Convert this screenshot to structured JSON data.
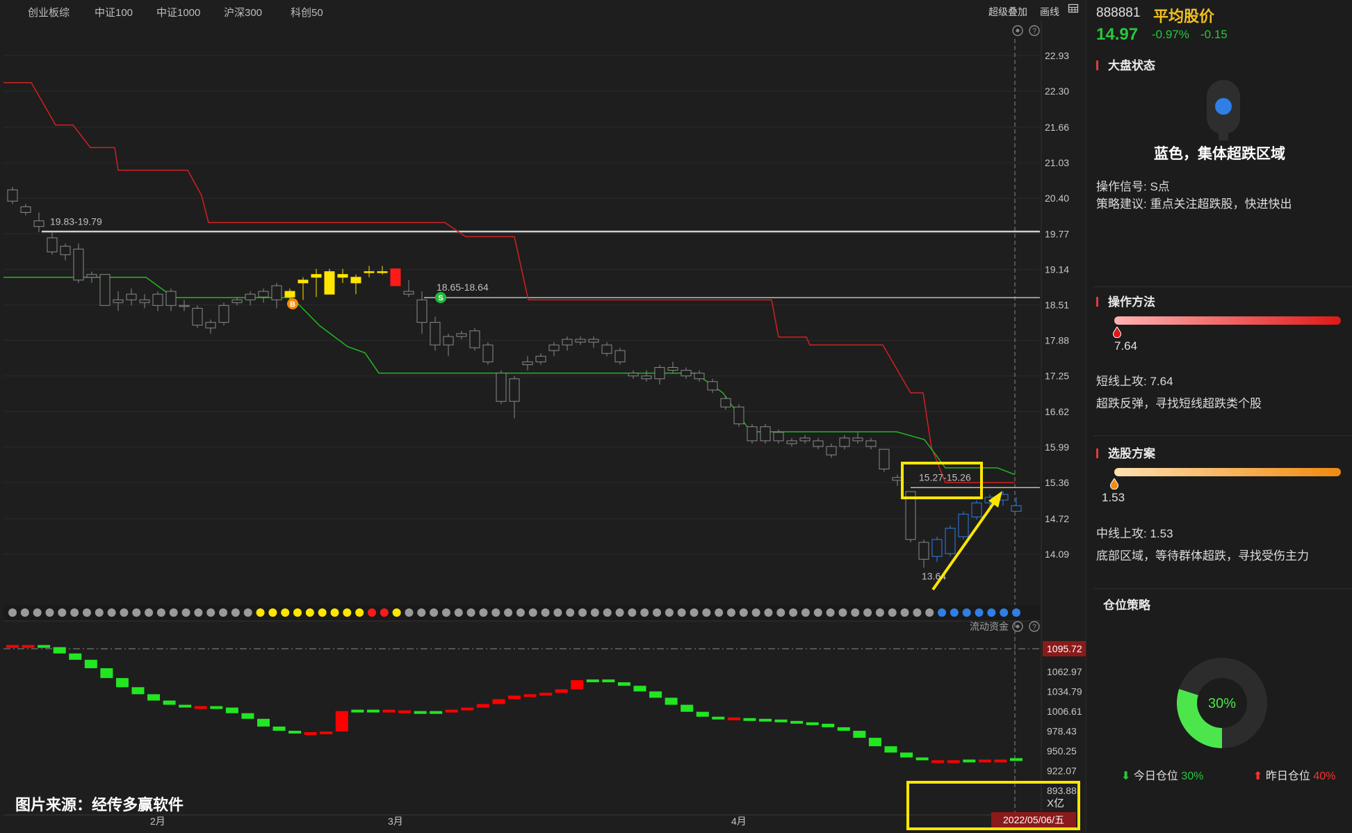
{
  "tabs": [
    "创业板综",
    "中证100",
    "中证1000",
    "沪深300",
    "科创50"
  ],
  "toolbar": {
    "overlay": "超级叠加",
    "draw": "画线",
    "grid_icon": "grid-icon"
  },
  "chart_data": [
    {
      "type": "candlestick",
      "title": "",
      "y_tick_labels": [
        "22.93",
        "22.30",
        "21.66",
        "21.03",
        "20.40",
        "19.77",
        "19.14",
        "18.51",
        "17.88",
        "17.25",
        "16.62",
        "15.99",
        "15.36",
        "14.72",
        "14.09"
      ],
      "ylim": [
        13.6,
        23.3
      ],
      "x_tick_labels": [
        "2月",
        "3月",
        "4月"
      ],
      "annotations": [
        "19.83-19.79",
        "18.65-18.64",
        "15.27-15.26",
        "13.64"
      ],
      "signal_badges": [
        "B",
        "S"
      ],
      "levels": [
        19.81,
        18.64,
        15.27
      ],
      "series": [
        {
          "name": "红线",
          "color": "#d42020"
        },
        {
          "name": "绿线",
          "color": "#22b822"
        }
      ],
      "candles_ohlc": [
        [
          20.55,
          20.6,
          20.3,
          20.35
        ],
        [
          20.25,
          20.3,
          20.1,
          20.15
        ],
        [
          20.0,
          20.15,
          19.8,
          19.9
        ],
        [
          19.7,
          19.8,
          19.4,
          19.45
        ],
        [
          19.4,
          19.6,
          19.3,
          19.55
        ],
        [
          19.5,
          19.6,
          18.9,
          18.95
        ],
        [
          19.0,
          19.1,
          18.9,
          19.05
        ],
        [
          19.05,
          19.05,
          18.5,
          18.5
        ],
        [
          18.55,
          18.75,
          18.4,
          18.6
        ],
        [
          18.6,
          18.8,
          18.5,
          18.7
        ],
        [
          18.6,
          18.7,
          18.45,
          18.55
        ],
        [
          18.5,
          18.75,
          18.4,
          18.7
        ],
        [
          18.5,
          18.8,
          18.4,
          18.75
        ],
        [
          18.5,
          18.6,
          18.4,
          18.5
        ],
        [
          18.45,
          18.5,
          18.1,
          18.15
        ],
        [
          18.1,
          18.25,
          18.0,
          18.2
        ],
        [
          18.2,
          18.55,
          18.15,
          18.5
        ],
        [
          18.55,
          18.65,
          18.5,
          18.6
        ],
        [
          18.6,
          18.75,
          18.5,
          18.7
        ],
        [
          18.65,
          18.8,
          18.55,
          18.75
        ],
        [
          18.6,
          18.9,
          18.45,
          18.85
        ],
        [
          18.65,
          18.8,
          18.5,
          18.75
        ],
        [
          18.9,
          19.0,
          18.6,
          18.95
        ],
        [
          19.0,
          19.15,
          18.65,
          19.05
        ],
        [
          19.1,
          19.15,
          18.7,
          18.7
        ],
        [
          19.05,
          19.15,
          18.9,
          19.0
        ],
        [
          18.9,
          19.05,
          18.7,
          19.0
        ],
        [
          19.1,
          19.2,
          19.0,
          19.1
        ],
        [
          19.1,
          19.2,
          19.05,
          19.1
        ],
        [
          19.15,
          19.15,
          18.85,
          18.85
        ],
        [
          18.75,
          18.95,
          18.65,
          18.7
        ],
        [
          18.6,
          18.75,
          18.0,
          18.2
        ],
        [
          18.2,
          18.3,
          17.7,
          17.8
        ],
        [
          17.8,
          18.0,
          17.6,
          17.95
        ],
        [
          17.95,
          18.05,
          17.9,
          18.0
        ],
        [
          18.05,
          18.1,
          17.7,
          17.75
        ],
        [
          17.8,
          17.85,
          17.45,
          17.5
        ],
        [
          17.3,
          17.35,
          16.75,
          16.8
        ],
        [
          16.8,
          17.25,
          16.5,
          17.2
        ],
        [
          17.45,
          17.6,
          17.35,
          17.5
        ],
        [
          17.5,
          17.65,
          17.45,
          17.6
        ],
        [
          17.7,
          17.85,
          17.6,
          17.8
        ],
        [
          17.8,
          17.95,
          17.7,
          17.9
        ],
        [
          17.9,
          17.95,
          17.8,
          17.85
        ],
        [
          17.85,
          17.95,
          17.75,
          17.9
        ],
        [
          17.8,
          17.85,
          17.6,
          17.65
        ],
        [
          17.5,
          17.75,
          17.45,
          17.7
        ],
        [
          17.3,
          17.35,
          17.2,
          17.25
        ],
        [
          17.25,
          17.35,
          17.15,
          17.2
        ],
        [
          17.2,
          17.45,
          17.1,
          17.4
        ],
        [
          17.4,
          17.5,
          17.3,
          17.35
        ],
        [
          17.35,
          17.4,
          17.2,
          17.25
        ],
        [
          17.3,
          17.35,
          17.15,
          17.2
        ],
        [
          17.15,
          17.2,
          16.95,
          17.0
        ],
        [
          16.85,
          16.9,
          16.65,
          16.7
        ],
        [
          16.7,
          16.75,
          16.35,
          16.4
        ],
        [
          16.35,
          16.4,
          16.05,
          16.1
        ],
        [
          16.1,
          16.4,
          16.05,
          16.35
        ],
        [
          16.25,
          16.3,
          16.05,
          16.1
        ],
        [
          16.05,
          16.15,
          16.0,
          16.1
        ],
        [
          16.1,
          16.2,
          16.05,
          16.15
        ],
        [
          16.1,
          16.15,
          15.95,
          16.0
        ],
        [
          15.85,
          16.05,
          15.8,
          16.0
        ],
        [
          16.0,
          16.2,
          15.95,
          16.15
        ],
        [
          16.15,
          16.25,
          16.05,
          16.1
        ],
        [
          16.1,
          16.15,
          15.95,
          16.0
        ],
        [
          15.95,
          15.95,
          15.55,
          15.6
        ],
        [
          15.45,
          15.5,
          15.3,
          15.4
        ],
        [
          15.2,
          15.2,
          14.3,
          14.35
        ],
        [
          14.3,
          14.35,
          13.85,
          14.0
        ],
        [
          14.05,
          14.4,
          13.95,
          14.35
        ],
        [
          14.1,
          14.6,
          14.05,
          14.55
        ],
        [
          14.4,
          14.85,
          14.35,
          14.8
        ],
        [
          14.75,
          15.05,
          14.7,
          15.0
        ],
        [
          15.0,
          15.15,
          14.85,
          15.1
        ],
        [
          15.15,
          15.2,
          14.95,
          15.05
        ],
        [
          14.95,
          15.1,
          14.85,
          14.85
        ]
      ]
    },
    {
      "type": "bar",
      "title": "流动资金",
      "y_tick_labels": [
        "1095.72",
        "1062.97",
        "1034.79",
        "1006.61",
        "978.43",
        "950.25",
        "922.07",
        "893.88"
      ],
      "unit_label": "X亿",
      "ylim": [
        880,
        1105
      ],
      "values": [
        1100,
        1101,
        1098,
        1089,
        1080,
        1068,
        1054,
        1041,
        1031,
        1022,
        1016,
        1014,
        1014,
        1012,
        1004,
        996,
        985,
        979,
        977,
        976,
        978,
        1007,
        1009,
        1009,
        1008,
        1007,
        1007,
        1007,
        1009,
        1012,
        1017,
        1024,
        1029,
        1031,
        1033,
        1038,
        1051,
        1052,
        1048,
        1043,
        1035,
        1026,
        1016,
        1006,
        999,
        998,
        997,
        996,
        995,
        993,
        991,
        989,
        984,
        979,
        969,
        957,
        948,
        941,
        937,
        936,
        937,
        938,
        936,
        938,
        940
      ],
      "colors": [
        "r",
        "r",
        "g",
        "g",
        "g",
        "g",
        "g",
        "g",
        "g",
        "g",
        "g",
        "g",
        "r",
        "g",
        "g",
        "g",
        "g",
        "g",
        "g",
        "r",
        "r",
        "r",
        "g",
        "g",
        "r",
        "r",
        "g",
        "g",
        "r",
        "r",
        "r",
        "r",
        "r",
        "r",
        "r",
        "r",
        "r",
        "g",
        "g",
        "g",
        "g",
        "g",
        "g",
        "g",
        "g",
        "g",
        "r",
        "g",
        "g",
        "g",
        "g",
        "g",
        "g",
        "g",
        "g",
        "g",
        "g",
        "g",
        "g",
        "r",
        "r",
        "g",
        "r",
        "r",
        "g"
      ]
    }
  ],
  "signal_dots": "ggggggggggggggggggggyyyyyyyyyrrygggggggggggggggggggggggggggggggggggggggggggbbbbbbb",
  "date_label": "2022/05/06/五",
  "watermark": "图片来源：经传多赢软件",
  "highlight_price": "1095.72",
  "stock": {
    "code": "888881",
    "name": "平均股价",
    "price": "14.97",
    "change_pct": "-0.97%",
    "change": "-0.15"
  },
  "market_status": {
    "title": "大盘状态",
    "status_text": "蓝色，集体超跌区域",
    "signal": "操作信号: S点",
    "advice": "策略建议: 重点关注超跌股，快进快出",
    "light_color": "#2f7fe6"
  },
  "operation": {
    "title": "操作方法",
    "value": "7.64",
    "value_fraction": 0.012,
    "line1": "短线上攻: 7.64",
    "line2": "超跌反弹，寻找短线超跌类个股"
  },
  "stock_selection": {
    "title": "选股方案",
    "value": "1.53",
    "value_fraction": 0.0,
    "line1": "中线上攻: 1.53",
    "line2": "底部区域，等待群体超跌，寻找受伤主力"
  },
  "position": {
    "title": "仓位策略",
    "pct_value": 30,
    "pct_label": "30%",
    "today_label": "今日仓位",
    "today_value": "30%",
    "yesterday_label": "昨日仓位",
    "yesterday_value": "40%"
  },
  "colors": {
    "up": "#ff1a1a",
    "down": "#22e622",
    "yellow": "#ffe600",
    "blue": "#2f7fe6",
    "price_green": "#28c83c",
    "gold": "#f0c020"
  }
}
